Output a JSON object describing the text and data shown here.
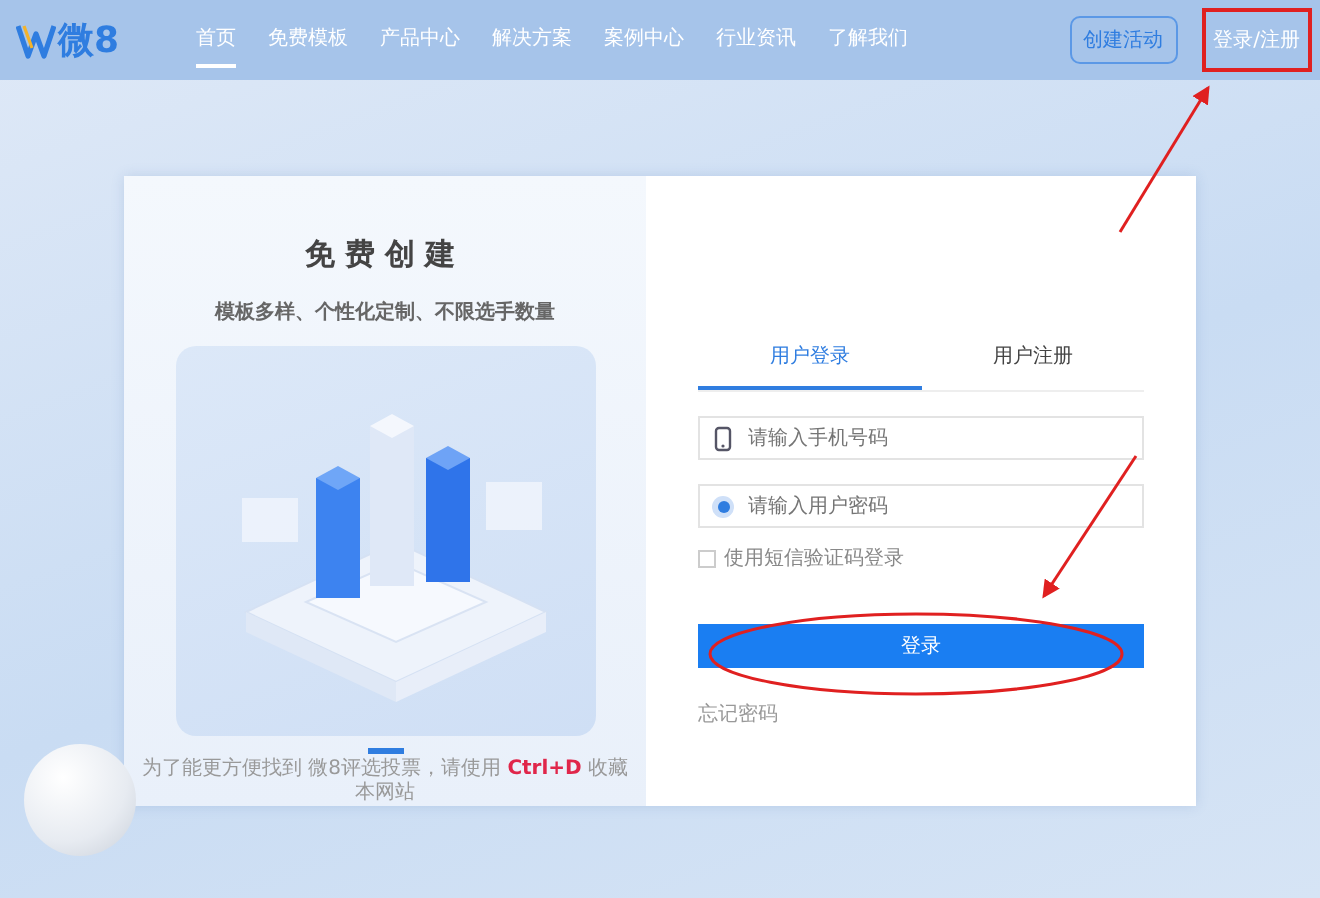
{
  "header": {
    "logo_text": "微8",
    "nav": [
      {
        "label": "首页",
        "selected": true
      },
      {
        "label": "免费模板",
        "selected": false
      },
      {
        "label": "产品中心",
        "selected": false
      },
      {
        "label": "解决方案",
        "selected": false
      },
      {
        "label": "案例中心",
        "selected": false
      },
      {
        "label": "行业资讯",
        "selected": false
      },
      {
        "label": "了解我们",
        "selected": false
      }
    ],
    "create_button": "创建活动",
    "login_link": "登录/注册"
  },
  "promo": {
    "title": "免费创建",
    "subtitle": "模板多样、个性化定制、不限选手数量",
    "bookmark_note": "为了能更方便找到 微8评选投票，请使用 **Ctrl+D** 收藏本网站"
  },
  "login": {
    "tabs": [
      {
        "label": "用户登录",
        "selected": true
      },
      {
        "label": "用户注册",
        "selected": false
      }
    ],
    "fields": [
      {
        "kind": "phone",
        "placeholder": "请输入手机号码"
      },
      {
        "kind": "password",
        "placeholder": "请输入用户密码"
      }
    ],
    "sms_login": {
      "label": "使用短信验证码登录",
      "checked": false
    },
    "submit": "登录",
    "forgot": "忘记密码"
  }
}
